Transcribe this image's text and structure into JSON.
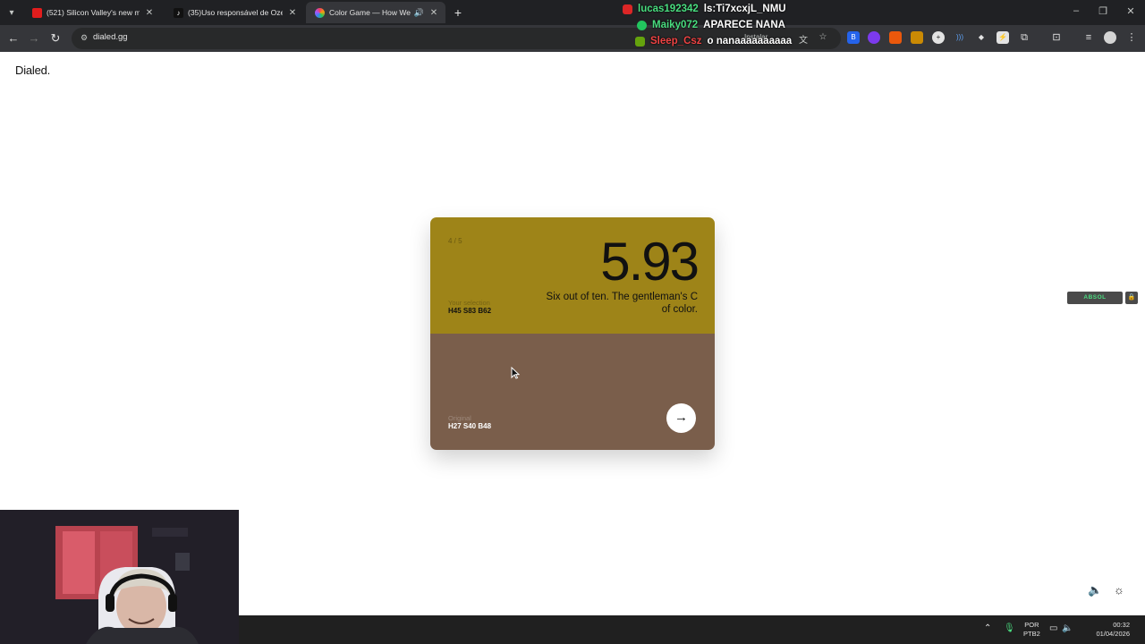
{
  "browser": {
    "tabs": [
      {
        "title": "(521) Silicon Valley's new mirac",
        "favicon": "youtube-icon",
        "active": false
      },
      {
        "title": "(35)Uso responsável de Ozemp",
        "favicon": "tiktok-icon",
        "active": false
      },
      {
        "title": "Color Game — How Well C",
        "favicon": "color-wheel-icon",
        "active": true
      }
    ],
    "url": "dialed.gg",
    "install_label": "Instalar"
  },
  "chat": [
    {
      "user": "lucas192342",
      "message": "ls:Ti7xcxjL_NMU",
      "user_color": "#4ade80"
    },
    {
      "user": "Maiky072",
      "message": "APARECE NANA",
      "user_color": "#4ade80"
    },
    {
      "user": "Sleep_Csz",
      "message": "o nanaaaaaaaaaa",
      "user_color": "#ef4444"
    }
  ],
  "page": {
    "logo": "Dialed.",
    "round": "4 / 5",
    "score": "5.93",
    "verdict": "Six out of ten. The gentleman's C of color.",
    "selection_label": "Your selection",
    "selection_value": "H45 S83 B62",
    "original_label": "Original",
    "original_value": "H27 S40 B48",
    "selection_color": "#9e8418",
    "original_color": "#7a5e4b"
  },
  "overlay": {
    "badge": "ABSOL"
  },
  "taskbar": {
    "lang_top": "POR",
    "lang_bottom": "PTB2",
    "time": "00:32",
    "date": "01/04/2026"
  }
}
